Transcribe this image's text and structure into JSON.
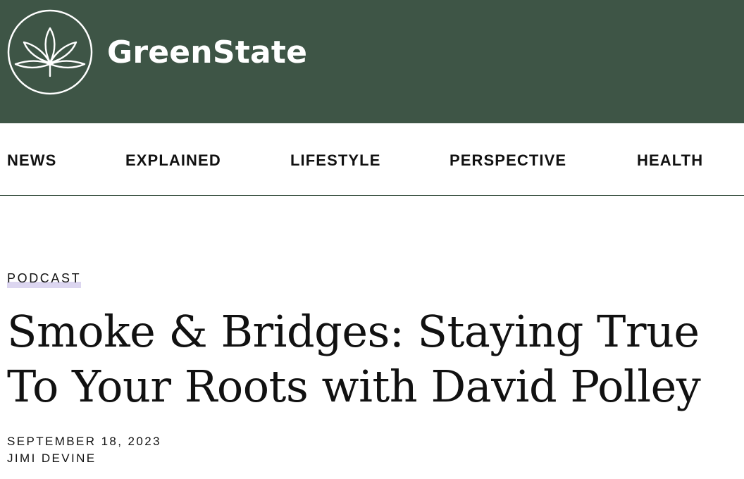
{
  "header": {
    "site_name": "GreenState",
    "logo_icon": "cannabis-leaf-icon",
    "background_color": "#3e5546"
  },
  "nav": {
    "items": [
      {
        "label": "NEWS"
      },
      {
        "label": "EXPLAINED"
      },
      {
        "label": "LIFESTYLE"
      },
      {
        "label": "PERSPECTIVE"
      },
      {
        "label": "HEALTH"
      }
    ]
  },
  "article": {
    "category": "PODCAST",
    "category_highlight_color": "#dcd6f0",
    "title": "Smoke & Bridges: Staying True To Your Roots with David Polley",
    "date": "SEPTEMBER 18, 2023",
    "author": "JIMI DEVINE"
  }
}
